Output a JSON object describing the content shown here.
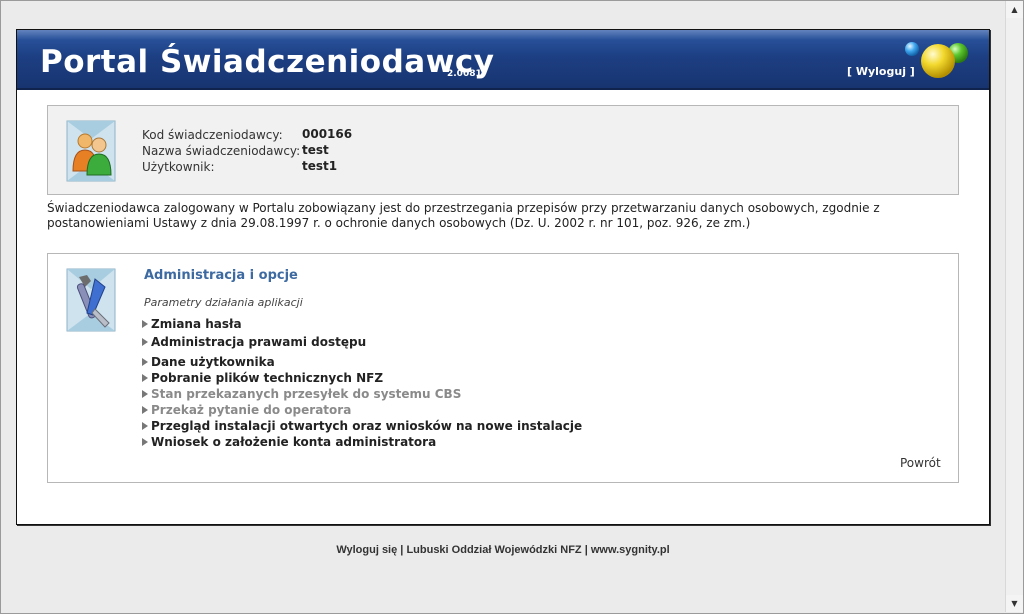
{
  "header": {
    "title": "Portal Świadczeniodawcy",
    "version": "2.0081",
    "logout_label": "[ Wyloguj ]"
  },
  "provider_info": {
    "rows": [
      {
        "label": "Kod świadczeniodawcy:",
        "value": "000166"
      },
      {
        "label": "Nazwa świadczeniodawcy:",
        "value": "test"
      },
      {
        "label": "Użytkownik:",
        "value": "test1"
      }
    ]
  },
  "notice": "Świadczeniodawca zalogowany w Portalu zobowiązany jest do przestrzegania przepisów przy przetwarzaniu danych osobowych, zgodnie z postanowieniami Ustawy z dnia 29.08.1997 r. o ochronie danych osobowych (Dz. U. 2002 r. nr 101, poz. 926, ze zm.)",
  "admin": {
    "title": "Administracja i opcje",
    "subtitle": "Parametry działania aplikacji",
    "items": [
      {
        "label": "Zmiana hasła",
        "enabled": true
      },
      {
        "label": "Administracja prawami dostępu",
        "enabled": true
      },
      {
        "label": "Dane użytkownika",
        "enabled": true
      },
      {
        "label": "Pobranie plików technicznych NFZ",
        "enabled": true
      },
      {
        "label": "Stan przekazanych przesyłek do systemu CBS",
        "enabled": false
      },
      {
        "label": "Przekaż pytanie do operatora",
        "enabled": false
      },
      {
        "label": "Przegląd instalacji otwartych oraz wniosków na nowe instalacje",
        "enabled": true
      },
      {
        "label": "Wniosek o założenie konta administratora",
        "enabled": true
      }
    ],
    "back_label": "Powrót"
  },
  "footer": {
    "logout": "Wyloguj się",
    "sep": " | ",
    "branch": "Lubuski Oddział Wojewódzki NFZ",
    "site": "www.sygnity.pl"
  },
  "colors": {
    "header": "#1d3f83",
    "admin_title": "#3d6aa0",
    "disabled": "#8a8a8a"
  }
}
